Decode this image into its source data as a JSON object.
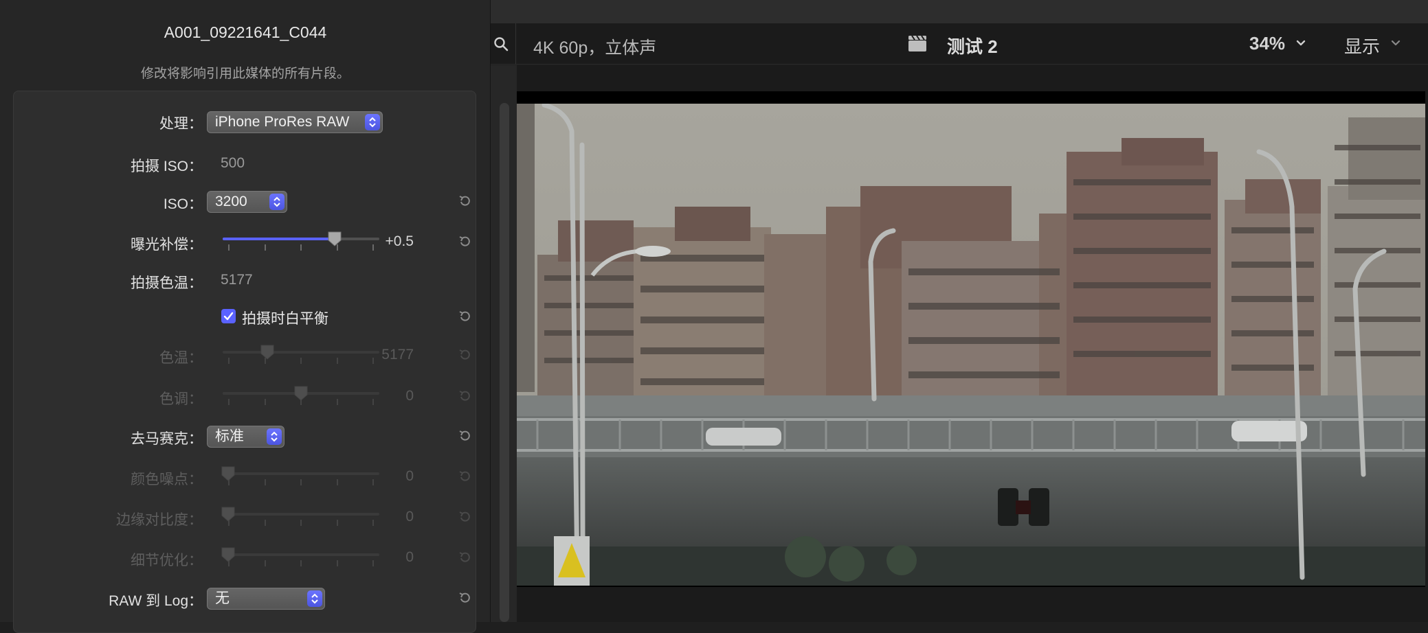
{
  "viewer": {
    "format": "4K 60p，立体声",
    "project": "测试 2",
    "zoom": "34%",
    "display": "显示"
  },
  "inspector": {
    "clip_name": "A001_09221641_C044",
    "notice": "修改将影响引用此媒体的所有片段。",
    "rows": {
      "process_label": "处理：",
      "process_value": "iPhone ProRes RAW",
      "shot_iso_label": "拍摄 ISO：",
      "shot_iso_value": "500",
      "iso_label": "ISO：",
      "iso_value": "3200",
      "exposure_label": "曝光补偿：",
      "exposure_value": "+0.5",
      "shot_temp_label": "拍摄色温：",
      "shot_temp_value": "5177",
      "wb_checkbox_label": "拍摄时白平衡",
      "temp_label": "色温：",
      "temp_value": "5177",
      "tint_label": "色调：",
      "tint_value": "0",
      "demosaic_label": "去马赛克：",
      "demosaic_value": "标准",
      "color_noise_label": "颜色噪点：",
      "color_noise_value": "0",
      "edge_contrast_label": "边缘对比度：",
      "edge_contrast_value": "0",
      "detail_label": "细节优化：",
      "detail_value": "0",
      "raw_log_label": "RAW 到 Log：",
      "raw_log_value": "无"
    },
    "slider_levels": {
      "exposure": 0.73,
      "temp": 0.27,
      "tint": 0.5,
      "color_noise": 0.0,
      "edge_contrast": 0.0,
      "detail": 0.0
    },
    "wb_checked": true
  },
  "colors": {
    "accent": "#5a62ff",
    "panel": "#2e2e2e",
    "viewer_bg": "#1b1b1b"
  },
  "icons": [
    "search-icon",
    "clapperboard-icon",
    "chevron-down-icon",
    "reset-arrow-icon",
    "checkmark-icon",
    "popup-stepper-icon"
  ]
}
